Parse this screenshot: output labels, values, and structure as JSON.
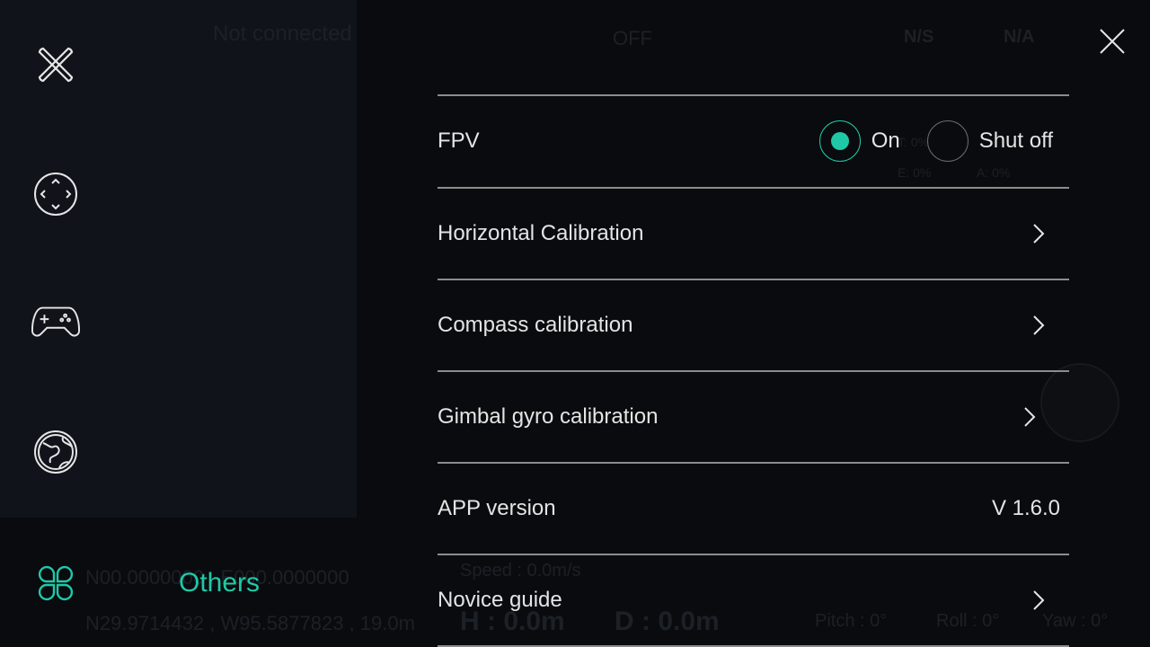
{
  "background": {
    "status": "Not connected",
    "top_bar": [
      "OFF",
      "N/S",
      "N/A"
    ],
    "telemetry": {
      "t": "T: 0%",
      "e": "E: 0%",
      "a": "A: 0%",
      "speed": "Speed : 0.0m/s",
      "h": "H : 0.0m",
      "d": "D : 0.0m",
      "pitch": "Pitch : 0°",
      "roll": "Roll : 0°",
      "yaw": "Yaw : 0°"
    },
    "coords": [
      "N00.0000000 , E000.0000000",
      "N29.9714432 , W95.5877823 , 19.0m"
    ]
  },
  "sidebar": {
    "items": [
      {
        "icon": "drone-icon"
      },
      {
        "icon": "gimbal-control-icon"
      },
      {
        "icon": "gamepad-icon"
      },
      {
        "icon": "globe-icon"
      },
      {
        "icon": "clover-icon",
        "label": "Others",
        "active": true
      }
    ]
  },
  "accent": "#1fc9a8",
  "settings": {
    "fpv": {
      "label": "FPV",
      "options": [
        "On",
        "Shut off"
      ],
      "selected": "On"
    },
    "horizontal": "Horizontal Calibration",
    "compass": "Compass calibration",
    "gimbal": "Gimbal gyro calibration",
    "app_version_label": "APP version",
    "app_version_value": "V 1.6.0",
    "novice": "Novice guide"
  }
}
